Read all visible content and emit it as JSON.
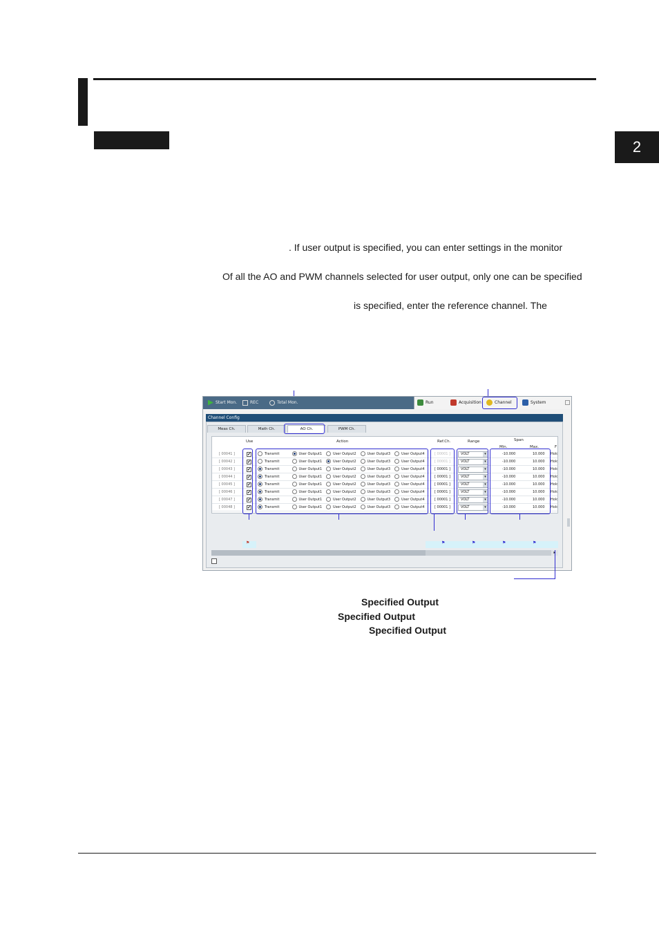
{
  "chapter": {
    "number": "2"
  },
  "body": {
    "line1": ". If user output is specified, you can enter settings in the monitor",
    "line2": "Of all the AO and PWM channels selected for user output, only one can be specified",
    "line3": "is specified, enter the reference channel. The"
  },
  "specified_output": {
    "line1": "Specified Output",
    "line2": "Specified Output",
    "line3": "Specified Output"
  },
  "screenshot": {
    "toolbar": {
      "start_label": "Start Mon.",
      "btn2_label": "REC",
      "btn3_label": "Total Mon."
    },
    "nav": {
      "run": "Run",
      "acquisition": "Acquisition",
      "channel": "Channel",
      "system": "System"
    },
    "panel_title": "Channel Config",
    "tabs": [
      "Meas Ch.",
      "Math Ch.",
      "AO Ch.",
      "PWM Ch."
    ],
    "columns": {
      "use": "Use",
      "action": "Action",
      "ref_ch": "Ref.Ch.",
      "range": "Range",
      "span": "Span",
      "min": "Min.",
      "max": "Max.",
      "extra": "F"
    },
    "actions": [
      "Transmit",
      "User Output1",
      "User Output2",
      "User Output3",
      "User Output4"
    ],
    "rows": [
      {
        "ch": "[ 00041 ]",
        "selected": 1,
        "ref": "[ 00001 ]",
        "range": "VOLT",
        "min": "-10.000",
        "max": "10.000",
        "extra": "Hold"
      },
      {
        "ch": "[ 00042 ]",
        "selected": 2,
        "ref": "[ 00001 ]",
        "range": "VOLT",
        "min": "-10.000",
        "max": "10.000",
        "extra": "Hold"
      },
      {
        "ch": "[ 00043 ]",
        "selected": 0,
        "ref": "[ 00001 ]",
        "range": "VOLT",
        "min": "-10.000",
        "max": "10.000",
        "extra": "Hold"
      },
      {
        "ch": "[ 00044 ]",
        "selected": 0,
        "ref": "[ 00001 ]",
        "range": "VOLT",
        "min": "-10.000",
        "max": "10.000",
        "extra": "Hold"
      },
      {
        "ch": "[ 00045 ]",
        "selected": 0,
        "ref": "[ 00001 ]",
        "range": "VOLT",
        "min": "-10.000",
        "max": "10.000",
        "extra": "Hold"
      },
      {
        "ch": "[ 00046 ]",
        "selected": 0,
        "ref": "[ 00001 ]",
        "range": "VOLT",
        "min": "-10.000",
        "max": "10.000",
        "extra": "Hold"
      },
      {
        "ch": "[ 00047 ]",
        "selected": 0,
        "ref": "[ 00001 ]",
        "range": "VOLT",
        "min": "-10.000",
        "max": "10.000",
        "extra": "Hold"
      },
      {
        "ch": "[ 00048 ]",
        "selected": 0,
        "ref": "[ 00001 ]",
        "range": "VOLT",
        "min": "-10.000",
        "max": "10.000",
        "extra": "Hold"
      }
    ]
  }
}
